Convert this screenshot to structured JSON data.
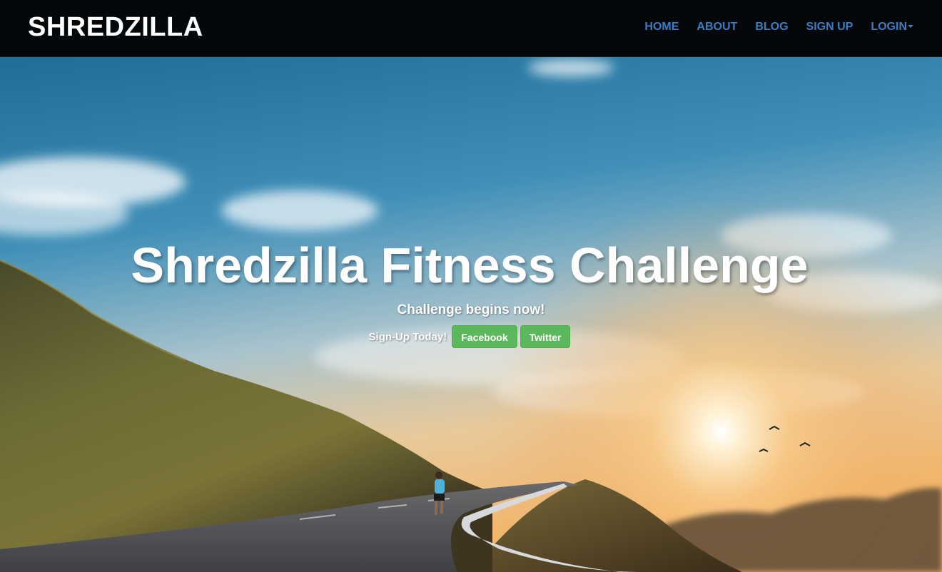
{
  "navbar": {
    "brand": "SHREDZILLA",
    "items": [
      {
        "label": "HOME"
      },
      {
        "label": "ABOUT"
      },
      {
        "label": "BLOG"
      },
      {
        "label": "SIGN UP"
      },
      {
        "label": "LOGIN"
      }
    ]
  },
  "hero": {
    "title": "Shredzilla Fitness Challenge",
    "subtitle": "Challenge begins now!",
    "cta_label": "Sign-Up Today!",
    "buttons": {
      "facebook": "Facebook",
      "twitter": "Twitter"
    }
  },
  "colors": {
    "navbar_bg": "#040709",
    "nav_link": "#3b7ec4",
    "button_green": "#5cb85c",
    "sky_top": "#2a7ca8",
    "sunset": "#f5c27a"
  },
  "icons": {
    "login_dropdown": "caret-down-icon"
  }
}
